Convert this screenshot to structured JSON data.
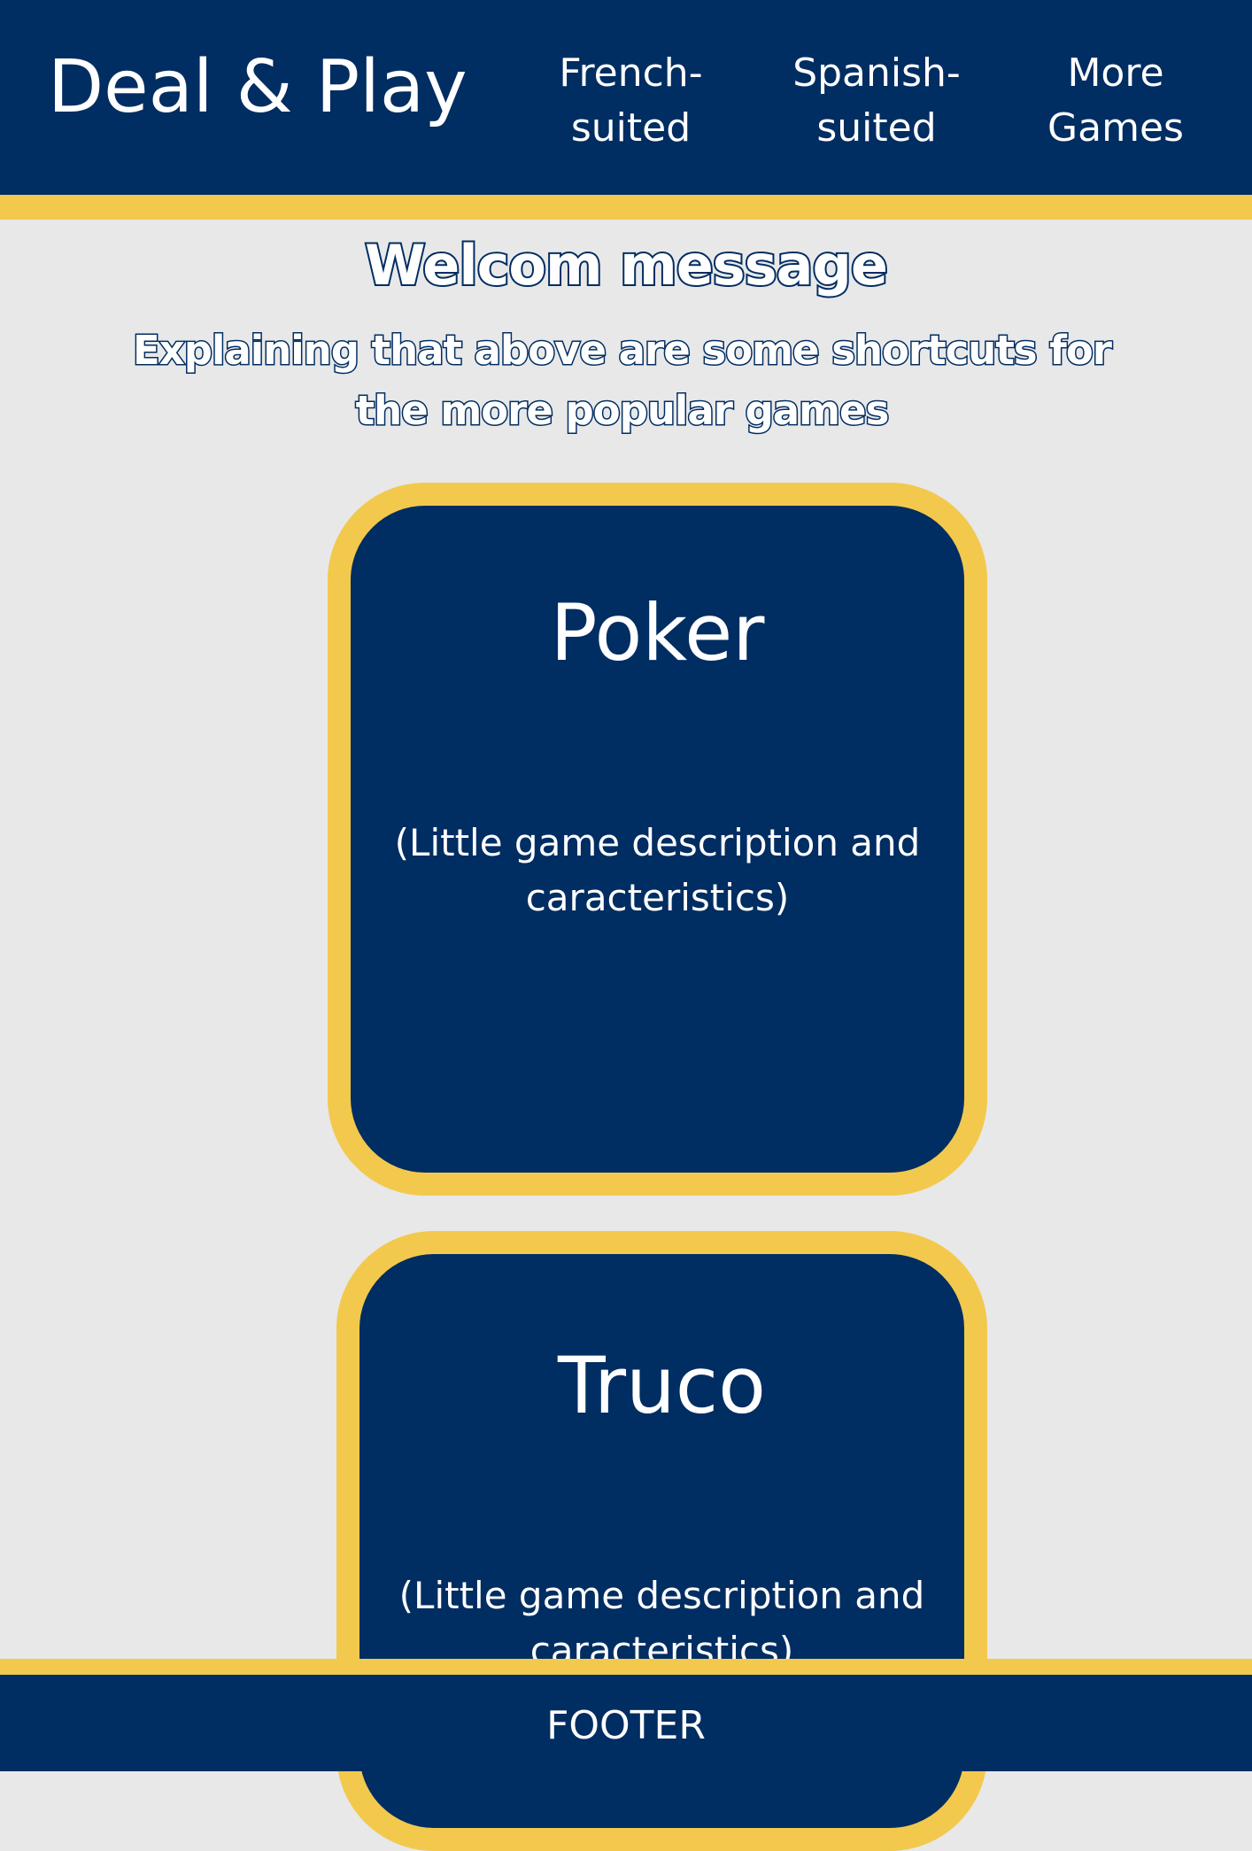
{
  "header": {
    "brand": "Deal & Play",
    "nav": {
      "french": "French-\nsuited",
      "spanish": "Spanish-\nsuited",
      "more": "More\nGames"
    }
  },
  "intro": {
    "welcome": "Welcom message",
    "explain": "Explaining that above are some shortcuts for the more popular games"
  },
  "cards": [
    {
      "title": "Poker",
      "description": "(Little game description and caracteristics)"
    },
    {
      "title": "Truco",
      "description": "(Little game description and caracteristics)"
    }
  ],
  "footer": {
    "text": "FOOTER"
  },
  "colors": {
    "navy": "#002d62",
    "gold": "#f2c94c",
    "background": "#e8e8e8",
    "text": "#ffffff"
  }
}
